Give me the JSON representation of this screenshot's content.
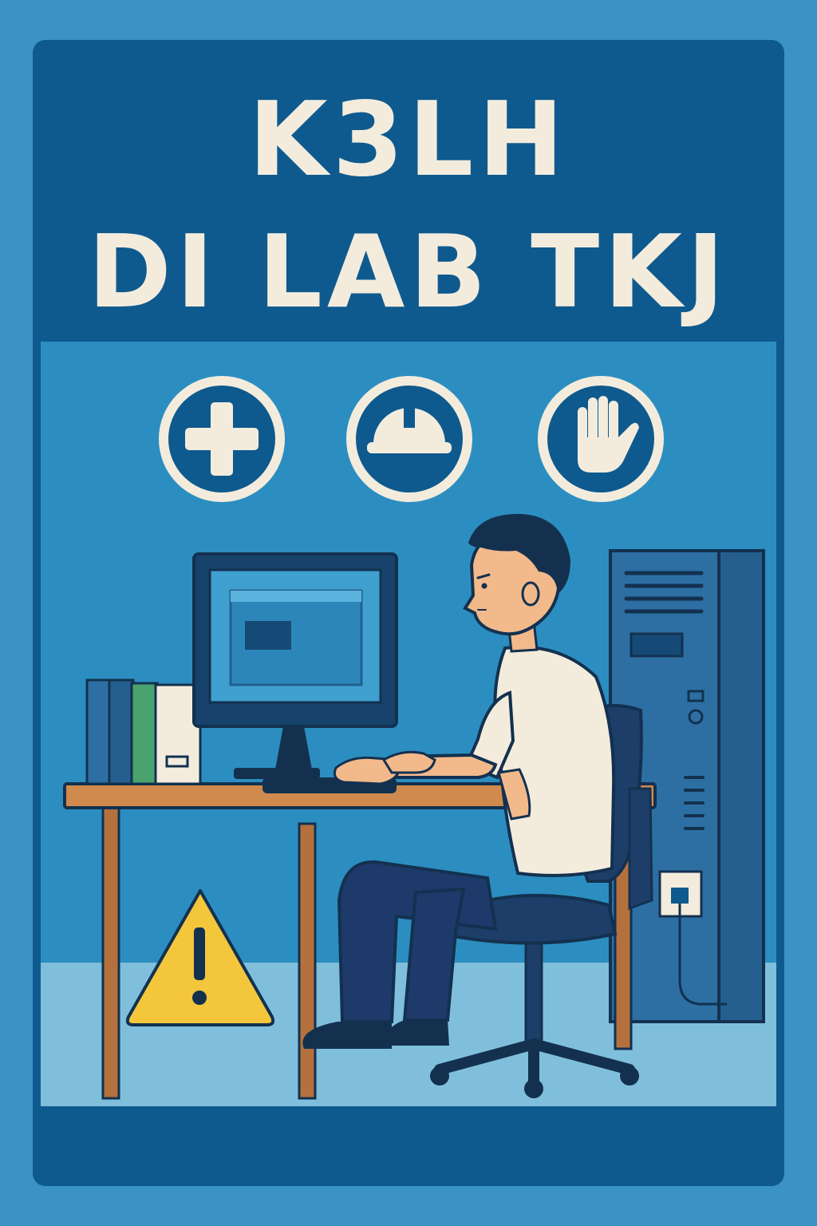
{
  "poster": {
    "title_line_1": "K3LH",
    "title_line_2": "DI LAB TKJ"
  },
  "icons": [
    {
      "name": "first-aid-cross-icon"
    },
    {
      "name": "safety-helmet-icon"
    },
    {
      "name": "stop-hand-icon"
    }
  ],
  "illustration": {
    "subject": "student-at-computer",
    "warning_sign": "warning-triangle-icon"
  },
  "colors": {
    "page_background": "#3a93c4",
    "poster_frame": "#0e5a8e",
    "scene_background": "#2c8ec0",
    "floor": "#7fbfdc",
    "title_text": "#f3ecdd",
    "icon_circle": "#0e5a8e",
    "icon_foreground": "#f3ecdd",
    "warning_yellow": "#f3c63c",
    "outline": "#13314f"
  }
}
